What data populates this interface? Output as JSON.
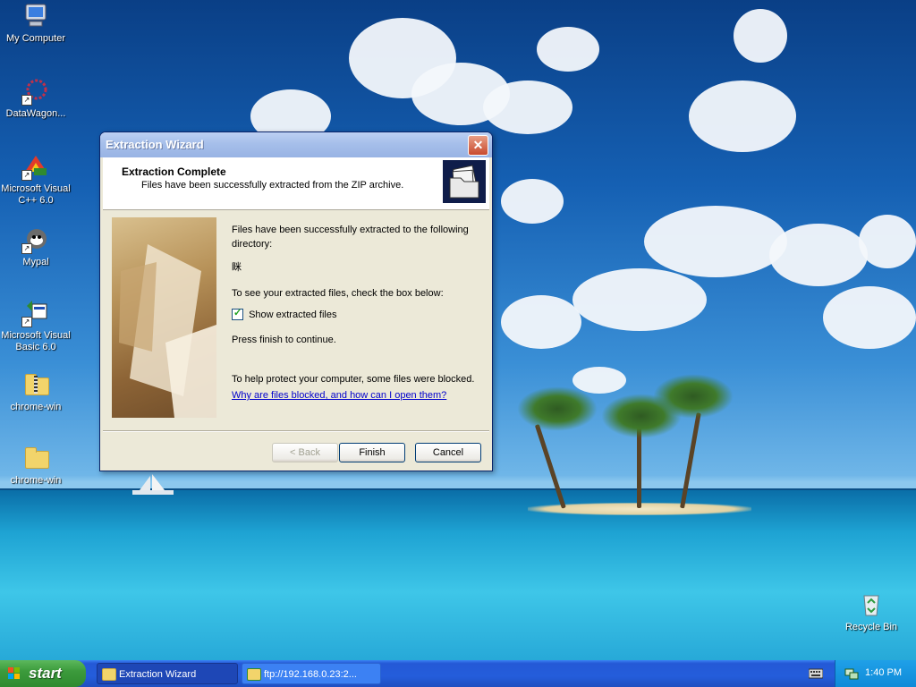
{
  "desktop": {
    "icons": [
      {
        "label": "My Computer",
        "icon": "computer-icon"
      },
      {
        "label": "DataWagon...",
        "icon": "datawagon-icon"
      },
      {
        "label": "Microsoft Visual C++ 6.0",
        "icon": "visual-cpp-icon"
      },
      {
        "label": "Mypal",
        "icon": "mypal-icon"
      },
      {
        "label": "Microsoft Visual Basic 6.0",
        "icon": "visual-basic-icon"
      },
      {
        "label": "chrome-win",
        "icon": "zip-folder-icon"
      },
      {
        "label": "chrome-win",
        "icon": "folder-icon"
      },
      {
        "label": "Recycle Bin",
        "icon": "recycle-bin-icon"
      }
    ]
  },
  "window": {
    "title": "Extraction Wizard",
    "close_symbol": "✕",
    "header_title": "Extraction Complete",
    "header_subtitle": "Files have been successfully extracted from the ZIP archive.",
    "para1": "Files have been successfully extracted to the following directory:",
    "directory": "眯",
    "para2": "To see your extracted files, check the box below:",
    "checkbox_label": "Show extracted files",
    "checkbox_checked": true,
    "para3": "Press finish to continue.",
    "para4": "To help protect your computer, some files were blocked.",
    "help_link": "Why are files blocked, and how can I open them?",
    "buttons": {
      "back": "< Back",
      "finish": "Finish",
      "cancel": "Cancel"
    }
  },
  "taskbar": {
    "start_label": "start",
    "tasks": [
      {
        "label": "Extraction Wizard",
        "active": true
      },
      {
        "label": "ftp://192.168.0.23:2...",
        "active": false
      }
    ],
    "clock": "1:40 PM"
  },
  "colors": {
    "titlebar": "#a6bfea",
    "dialog_bg": "#ece9d8",
    "taskbar": "#245ddb",
    "start": "#3c9b3c",
    "link": "#0000cc"
  }
}
